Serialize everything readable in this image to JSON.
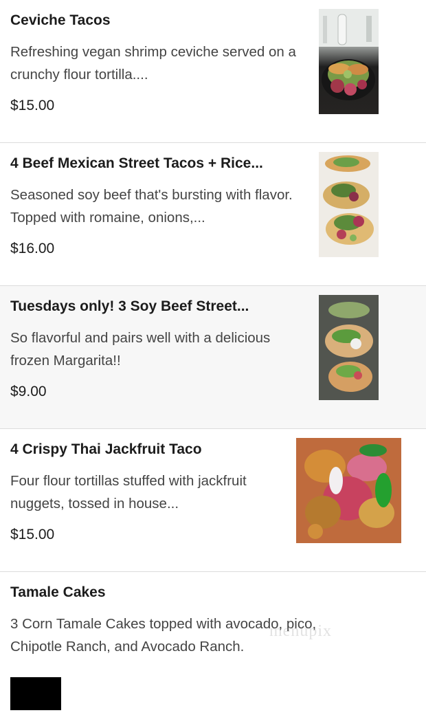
{
  "menu": {
    "items": [
      {
        "title": "Ceviche Tacos",
        "description": "Refreshing vegan shrimp ceviche served on a crunchy flour tortilla....",
        "price": "$15.00",
        "image_icon": "food-photo-icon"
      },
      {
        "title": "4 Beef Mexican Street Tacos + Rice...",
        "description": "Seasoned soy beef that's bursting with flavor. Topped with romaine, onions,...",
        "price": "$16.00",
        "image_icon": "food-photo-icon"
      },
      {
        "title": "Tuesdays only! 3 Soy Beef Street...",
        "description": "So flavorful and pairs well with a delicious frozen Margarita!!",
        "price": "$9.00",
        "image_icon": "food-photo-icon"
      },
      {
        "title": "4 Crispy Thai Jackfruit Taco",
        "description": "Four flour tortillas stuffed with jackfruit nuggets, tossed in house...",
        "price": "$15.00",
        "image_icon": "food-photo-icon"
      },
      {
        "title": "Tamale Cakes",
        "description": "3 Corn Tamale Cakes topped with avocado, pico, Chipotle Ranch, and Avocado Ranch.",
        "price": ""
      }
    ]
  },
  "watermark": {
    "text": "menupix"
  },
  "colors": {
    "background": "#ffffff",
    "alt_background": "#f7f7f7",
    "divider": "#dcdcdc",
    "title": "#1c1c1c",
    "description": "#444444"
  }
}
